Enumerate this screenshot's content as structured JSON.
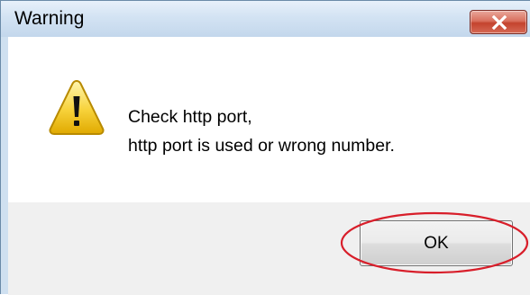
{
  "window": {
    "title": "Warning",
    "close_icon": "close-icon"
  },
  "message": {
    "icon": "warning-icon",
    "line1": "Check http port,",
    "line2": "http port is used or wrong number."
  },
  "buttons": {
    "ok_label": "OK"
  },
  "annotation": {
    "color": "#d81e2a",
    "shape": "ellipse around OK button"
  }
}
